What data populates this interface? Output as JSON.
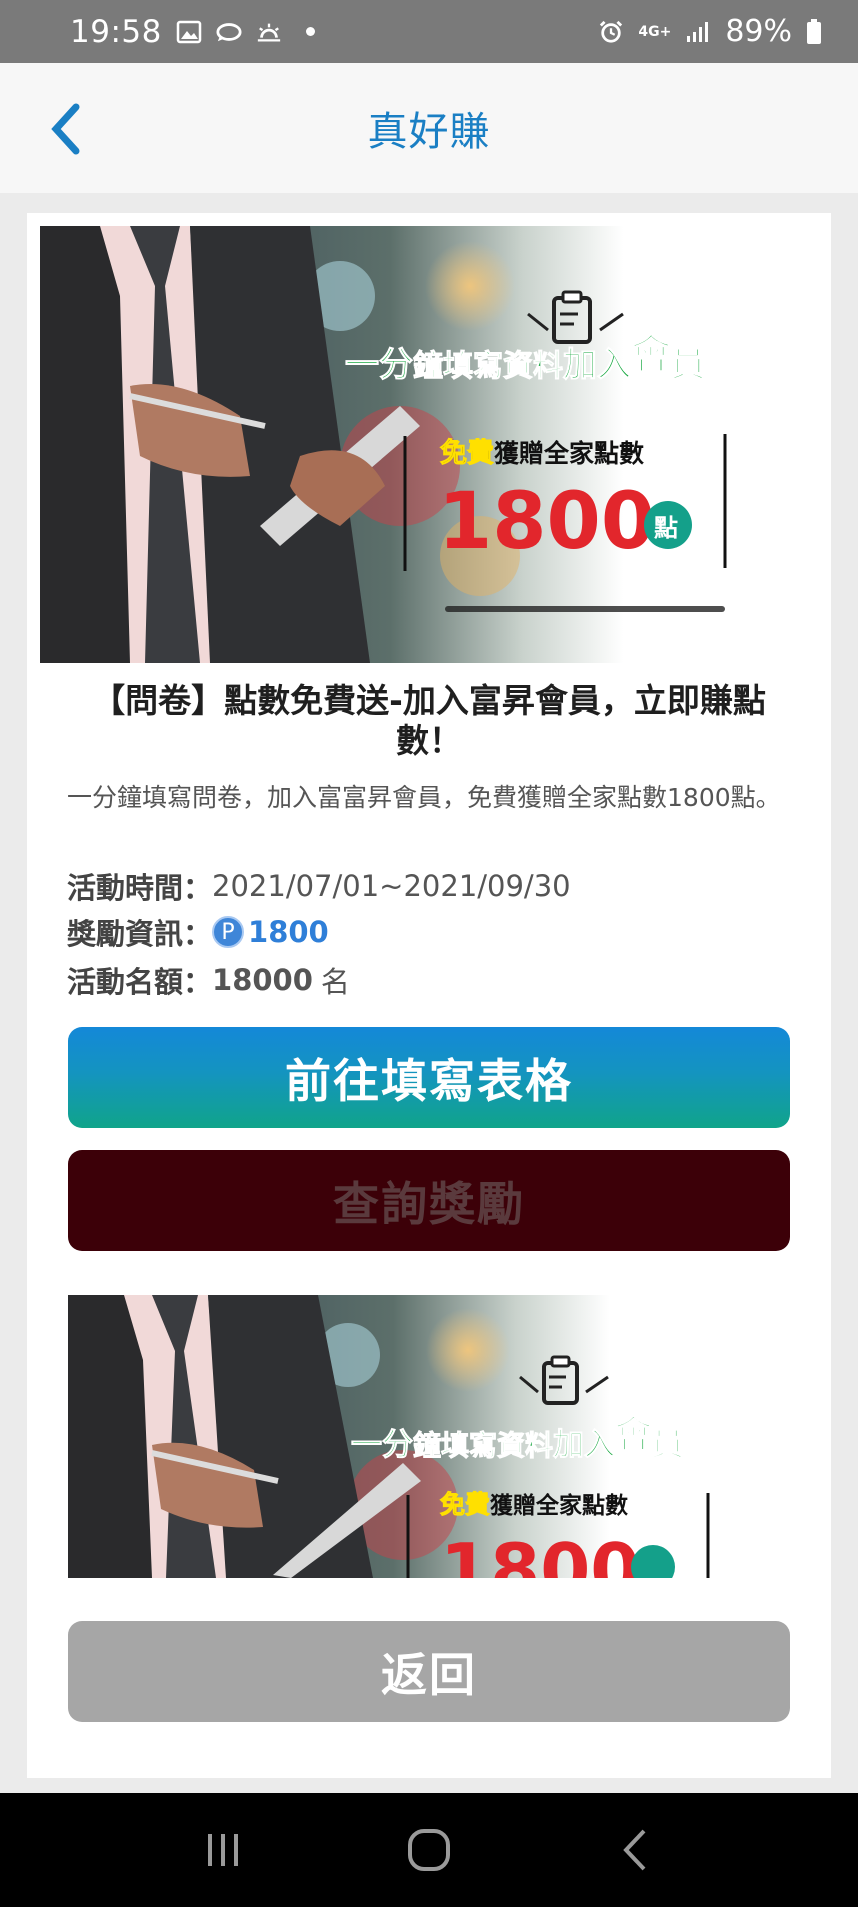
{
  "status_bar": {
    "time": "19:58",
    "network": "4G+",
    "battery": "89%"
  },
  "header": {
    "title": "真好賺",
    "back_icon": "chevron-left-icon"
  },
  "hero": {
    "headline_a": "一分",
    "headline_b": "鐘填寫資料",
    "headline_c": "加入",
    "headline_d": "會",
    "headline_e": "員",
    "free_label": "免費",
    "gift_label": "獲贈全家點數",
    "points_number": "1800",
    "points_unit": "點"
  },
  "article": {
    "title": "【問卷】點數免費送-加入富昇會員，立即賺點數！",
    "description": "一分鐘填寫問卷，加入富富昇會員，免費獲贈全家點數1800點。",
    "period_label": "活動時間：",
    "period_value": "2021/07/01~2021/09/30",
    "reward_label": "獎勵資訊：",
    "reward_badge": "P",
    "reward_value": "1800",
    "quota_label": "活動名額：",
    "quota_value": "18000",
    "quota_unit": "名"
  },
  "buttons": {
    "fill_form": "前往填寫表格",
    "check_reward": "查詢獎勵",
    "back": "返回"
  },
  "colors": {
    "accent": "#1a7fc4",
    "primary_gradient_top": "#1488d8",
    "primary_gradient_bottom": "#10a48a",
    "dark_button": "#3c0008",
    "back_button": "#a6a6a6"
  }
}
